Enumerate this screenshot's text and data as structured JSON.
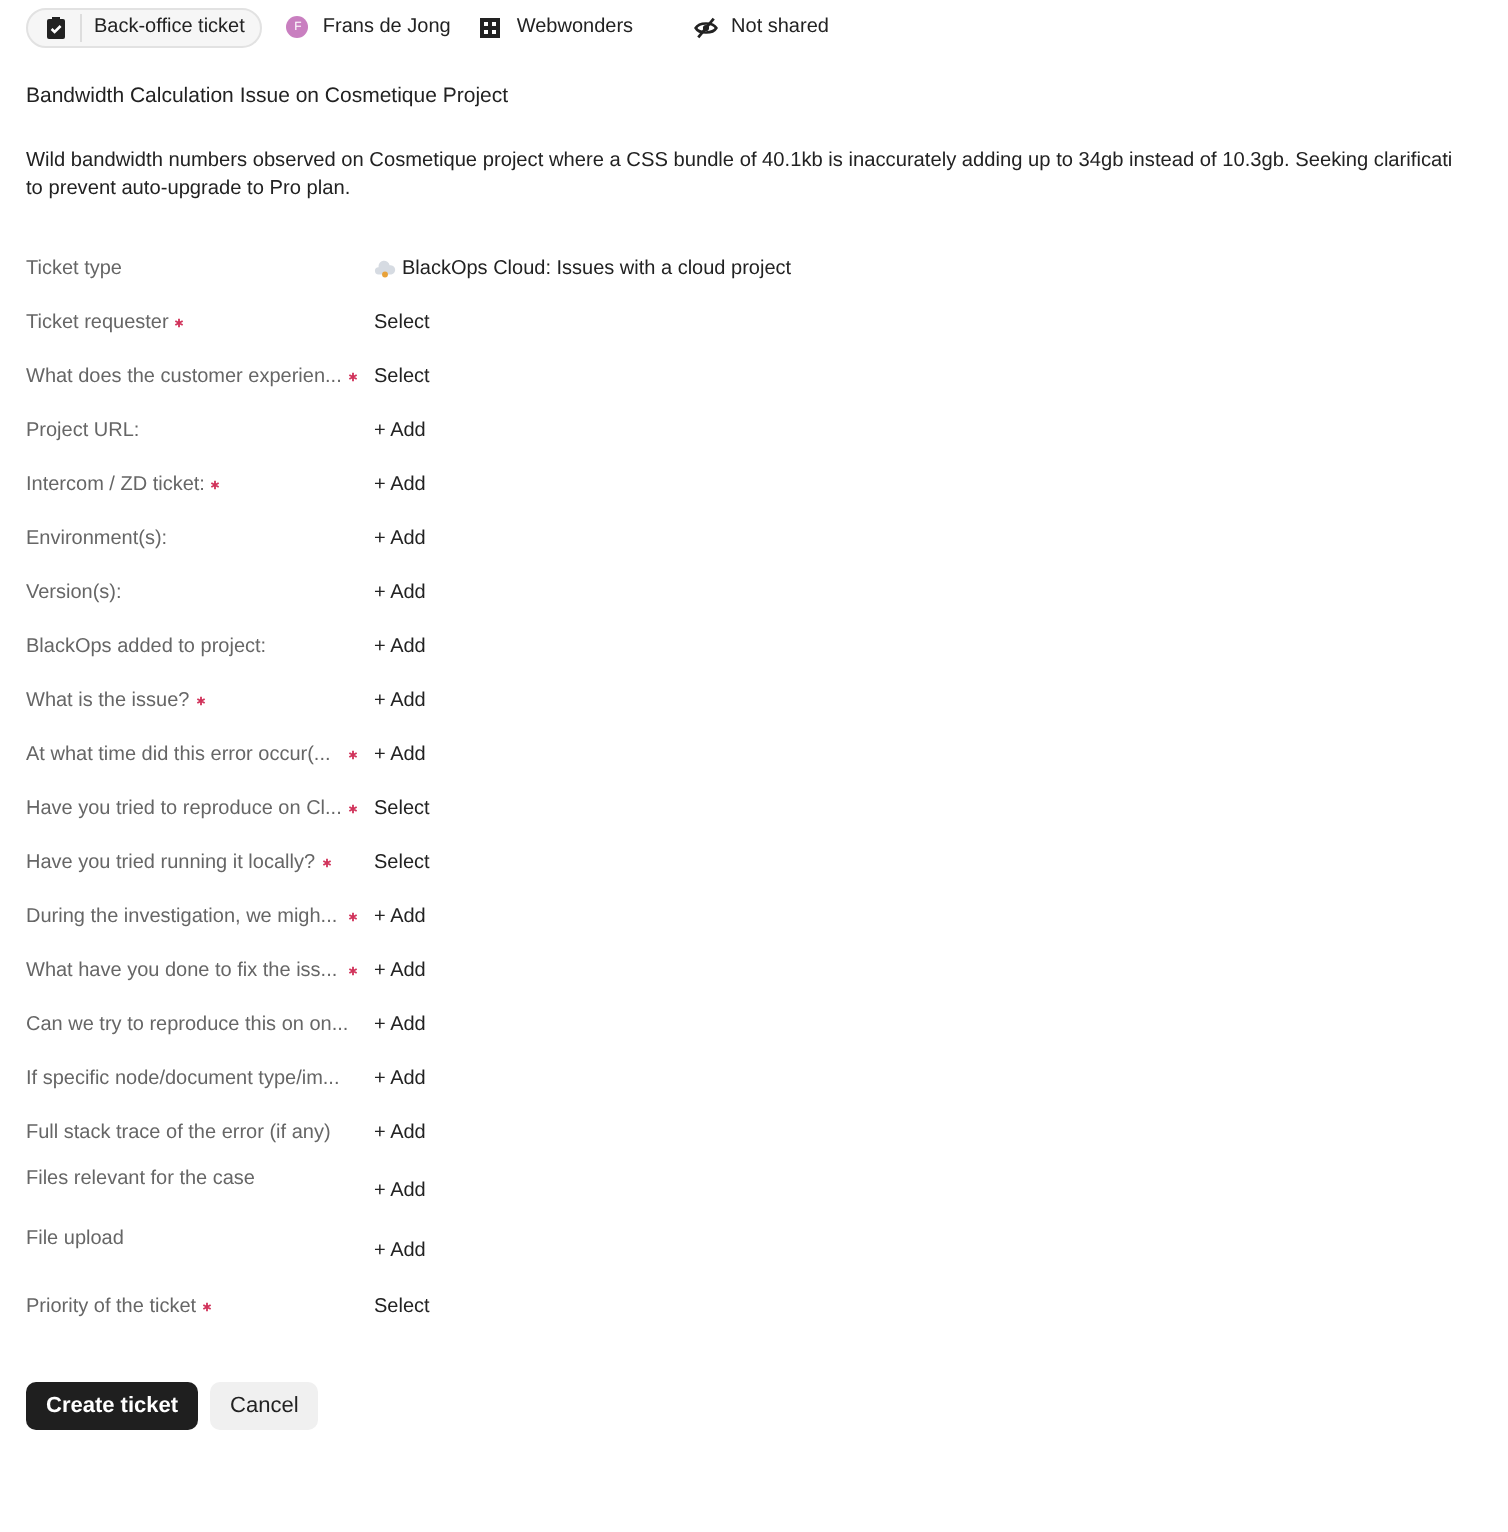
{
  "header": {
    "ticket_kind": "Back-office ticket",
    "assignee": {
      "initial": "F",
      "name": "Frans de Jong",
      "color": "#c97fc0"
    },
    "organization": "Webwonders",
    "sharing": "Not shared"
  },
  "title": "Bandwidth Calculation Issue on Cosmetique Project",
  "description_lines": [
    "Wild bandwidth numbers observed on Cosmetique project where a CSS bundle of 40.1kb is inaccurately adding up to 34gb instead of 10.3gb. Seeking clarificati",
    "to prevent auto-upgrade to Pro plan."
  ],
  "fields": [
    {
      "label": "Ticket type",
      "required": false,
      "kind": "type",
      "value": "BlackOps Cloud: Issues with a cloud project"
    },
    {
      "label": "Ticket requester",
      "required": true,
      "kind": "select",
      "value": "Select"
    },
    {
      "label": "What does the customer experien...",
      "required": true,
      "kind": "select",
      "value": "Select"
    },
    {
      "label": "Project URL:",
      "required": false,
      "kind": "add",
      "value": "+ Add"
    },
    {
      "label": "Intercom / ZD ticket:",
      "required": true,
      "kind": "add",
      "value": "+ Add"
    },
    {
      "label": "Environment(s):",
      "required": false,
      "kind": "add",
      "value": "+ Add"
    },
    {
      "label": "Version(s):",
      "required": false,
      "kind": "add",
      "value": "+ Add"
    },
    {
      "label": "BlackOps added to project:",
      "required": false,
      "kind": "add",
      "value": "+ Add"
    },
    {
      "label": "What is the issue?",
      "required": true,
      "kind": "add",
      "value": "+ Add"
    },
    {
      "label": "At what time did this error occur(...",
      "required": true,
      "kind": "add",
      "value": "+ Add"
    },
    {
      "label": "Have you tried to reproduce on Cl...",
      "required": true,
      "kind": "select",
      "value": "Select"
    },
    {
      "label": "Have you tried running it locally?",
      "required": true,
      "kind": "select",
      "value": "Select"
    },
    {
      "label": "During the investigation, we migh...",
      "required": true,
      "kind": "add",
      "value": "+ Add"
    },
    {
      "label": "What have you done to fix the iss...",
      "required": true,
      "kind": "add",
      "value": "+ Add"
    },
    {
      "label": "Can we try to reproduce this on on...",
      "required": false,
      "kind": "add",
      "value": "+ Add"
    },
    {
      "label": "If specific node/document type/im...",
      "required": false,
      "kind": "add",
      "value": "+ Add"
    },
    {
      "label": "Full stack trace of the error (if any)",
      "required": false,
      "kind": "add",
      "value": "+ Add"
    },
    {
      "label": "Files relevant for the case",
      "required": false,
      "kind": "file",
      "value": "+ Add"
    },
    {
      "label": "File upload",
      "required": false,
      "kind": "file",
      "value": "+ Add"
    },
    {
      "label": "Priority of the ticket",
      "required": true,
      "kind": "select",
      "value": "Select"
    }
  ],
  "buttons": {
    "create": "Create ticket",
    "cancel": "Cancel"
  }
}
